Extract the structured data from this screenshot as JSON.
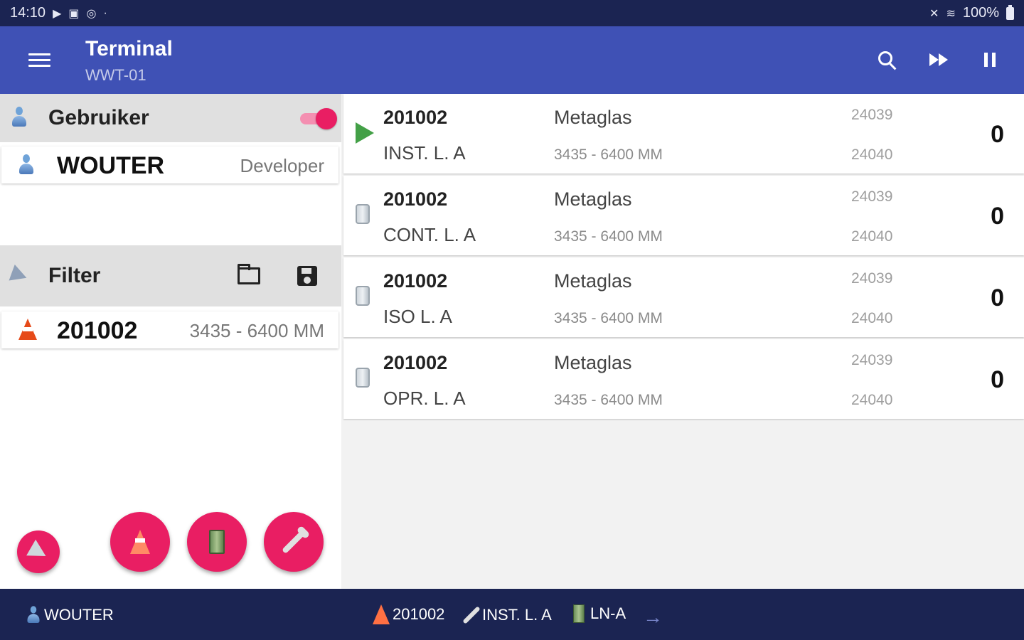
{
  "status_bar": {
    "time": "14:10",
    "left_icons": [
      "play-icon",
      "image-icon",
      "at-icon"
    ],
    "battery": "100%"
  },
  "app_bar": {
    "title": "Terminal",
    "subtitle": "WWT-01",
    "actions": [
      "search-icon",
      "fast-forward-icon",
      "pause-icon"
    ]
  },
  "user_section": {
    "header": "Gebruiker",
    "toggle_on": true,
    "name": "WOUTER",
    "role": "Developer"
  },
  "filter_section": {
    "header": "Filter",
    "value": "201002",
    "detail": "3435 - 6400 MM"
  },
  "rows": [
    {
      "icon": "play-icon",
      "code": "201002",
      "operation": "INST. L. A",
      "customer": "Metaglas",
      "dims": "3435 - 6400 MM",
      "ref1": "24039",
      "ref2": "24040",
      "count": "0"
    },
    {
      "icon": "can-icon",
      "code": "201002",
      "operation": "CONT. L. A",
      "customer": "Metaglas",
      "dims": "3435 - 6400 MM",
      "ref1": "24039",
      "ref2": "24040",
      "count": "0"
    },
    {
      "icon": "can-icon",
      "code": "201002",
      "operation": "ISO L. A",
      "customer": "Metaglas",
      "dims": "3435 - 6400 MM",
      "ref1": "24039",
      "ref2": "24040",
      "count": "0"
    },
    {
      "icon": "can-icon",
      "code": "201002",
      "operation": "OPR. L. A",
      "customer": "Metaglas",
      "dims": "3435 - 6400 MM",
      "ref1": "24039",
      "ref2": "24040",
      "count": "0"
    }
  ],
  "bottom_bar": {
    "user": "WOUTER",
    "order": "201002",
    "operation": "INST. L. A",
    "machine": "LN-A"
  },
  "colors": {
    "primary": "#3f51b5",
    "dark": "#1b2452",
    "accent": "#e91e63",
    "play": "#43a047"
  }
}
